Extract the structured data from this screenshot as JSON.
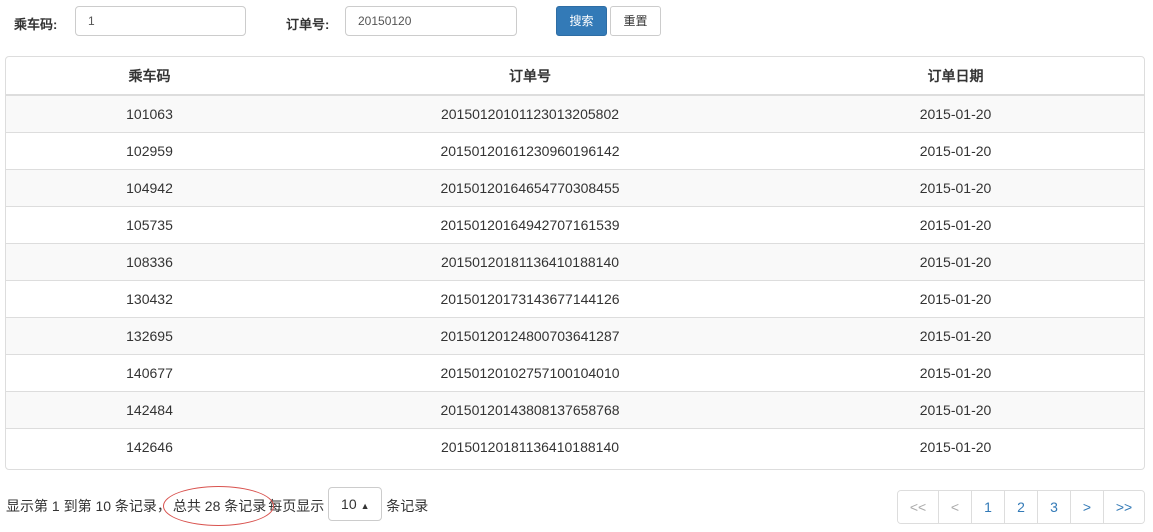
{
  "search": {
    "code_label": "乘车码:",
    "code_value": "1",
    "order_label": "订单号:",
    "order_value": "20150120",
    "search_button": "搜索",
    "reset_button": "重置"
  },
  "table": {
    "headers": [
      "乘车码",
      "订单号",
      "订单日期"
    ],
    "rows": [
      [
        "101063",
        "20150120101123013205802",
        "2015-01-20"
      ],
      [
        "102959",
        "20150120161230960196142",
        "2015-01-20"
      ],
      [
        "104942",
        "20150120164654770308455",
        "2015-01-20"
      ],
      [
        "105735",
        "20150120164942707161539",
        "2015-01-20"
      ],
      [
        "108336",
        "20150120181136410188140",
        "2015-01-20"
      ],
      [
        "130432",
        "20150120173143677144126",
        "2015-01-20"
      ],
      [
        "132695",
        "20150120124800703641287",
        "2015-01-20"
      ],
      [
        "140677",
        "20150120102757100104010",
        "2015-01-20"
      ],
      [
        "142484",
        "20150120143808137658768",
        "2015-01-20"
      ],
      [
        "142646",
        "20150120181136410188140",
        "2015-01-20"
      ]
    ]
  },
  "footer": {
    "showing_text": "显示第 1 到第 10 条记录，",
    "total_text": "总共 28 条记录",
    "per_page_prefix": "每页显示",
    "page_size": "10",
    "per_page_suffix": "条记录"
  },
  "pagination": {
    "first": "<<",
    "prev": "<",
    "pages": [
      "1",
      "2",
      "3"
    ],
    "next": ">",
    "last": ">>"
  },
  "colors": {
    "primary": "#337ab7",
    "annotation_circle": "#d9534f"
  },
  "icons": {
    "page_size_caret": "caret-up-icon"
  }
}
